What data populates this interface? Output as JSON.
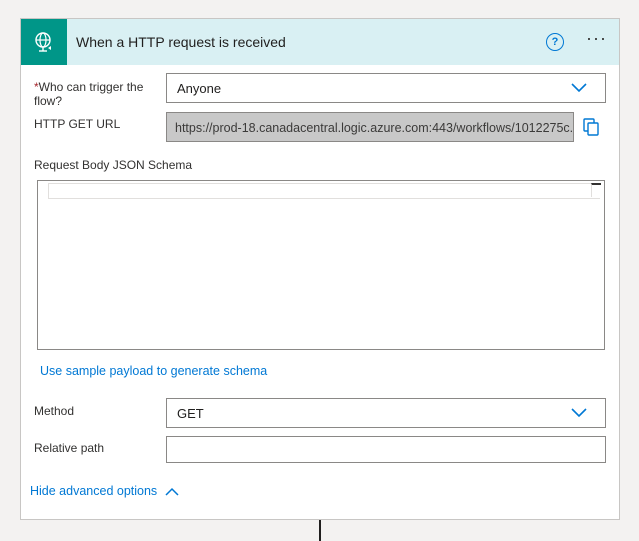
{
  "card": {
    "title": "When a HTTP request is received",
    "help_label": "?",
    "more_label": "···",
    "accent_color": "#009688",
    "header_color": "#d9f0f3"
  },
  "fields": {
    "who_can_trigger": {
      "required_mark": "*",
      "label": "Who can trigger the flow?",
      "value": "Anyone"
    },
    "http_get_url": {
      "label": "HTTP GET URL",
      "value": "https://prod-18.canadacentral.logic.azure.com:443/workflows/1012275c..."
    },
    "request_body_schema": {
      "label": "Request Body JSON Schema",
      "value": ""
    },
    "sample_payload_link": "Use sample payload to generate schema",
    "method": {
      "label": "Method",
      "value": "GET"
    },
    "relative_path": {
      "label": "Relative path",
      "value": ""
    }
  },
  "advanced": {
    "toggle_label": "Hide advanced options"
  }
}
